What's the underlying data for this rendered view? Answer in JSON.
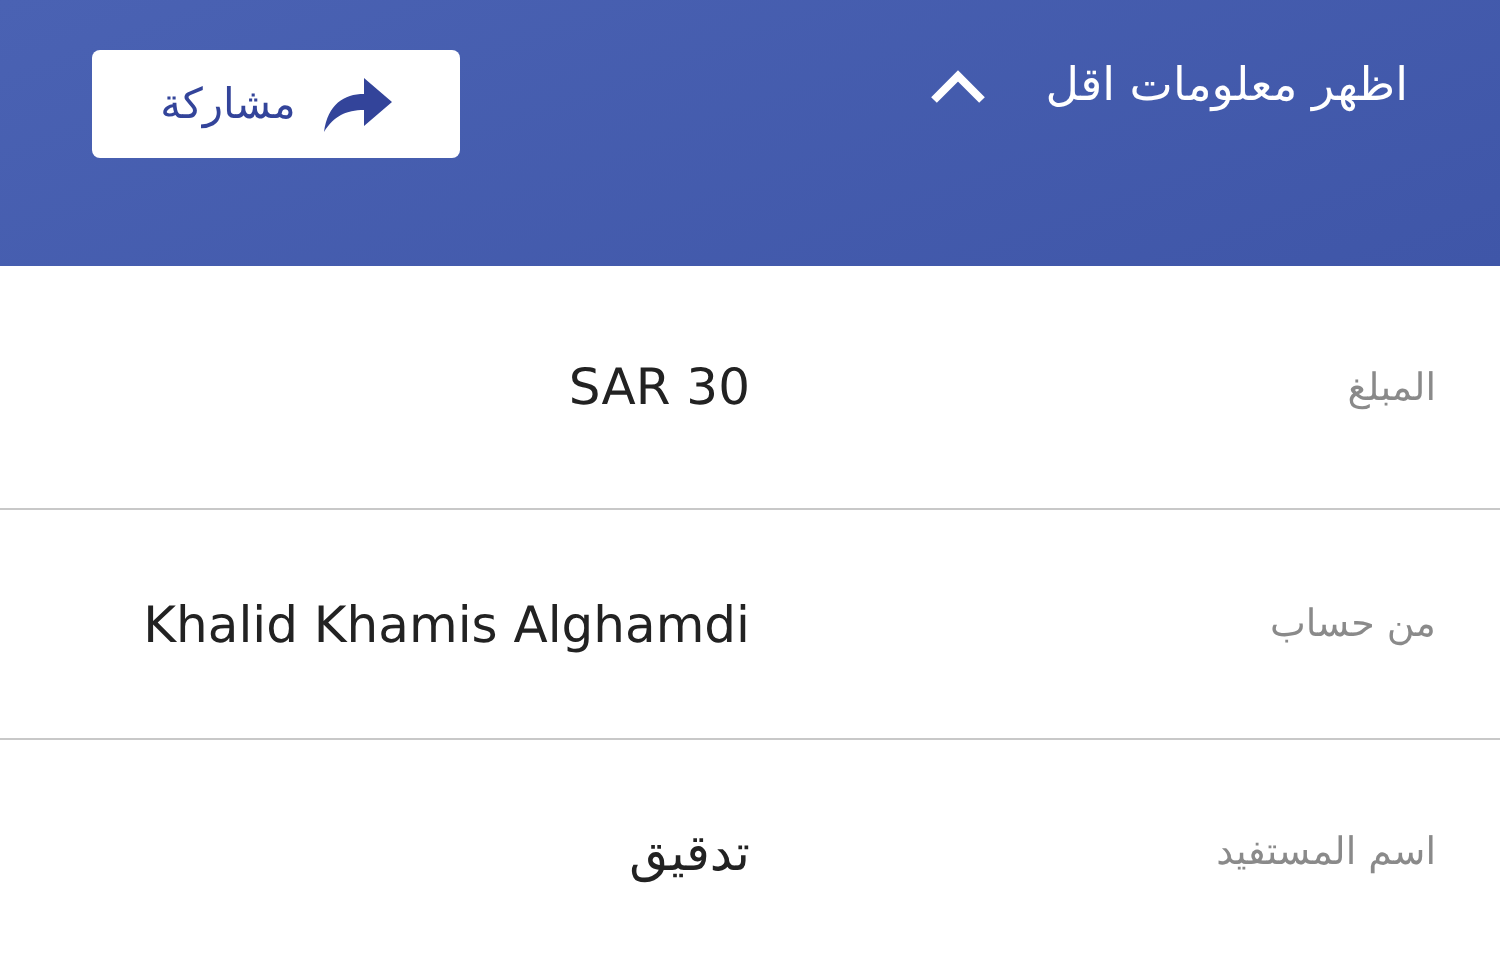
{
  "header": {
    "toggle": {
      "label": "اظهر معلومات اقل",
      "expanded": true
    },
    "share_button": {
      "label": "مشاركة"
    }
  },
  "details": [
    {
      "label": "المبلغ",
      "value": "SAR 30"
    },
    {
      "label": "من حساب",
      "value": "Khalid Khamis Alghamdi"
    },
    {
      "label": "اسم المستفيد",
      "value": "تدقيق"
    }
  ]
}
